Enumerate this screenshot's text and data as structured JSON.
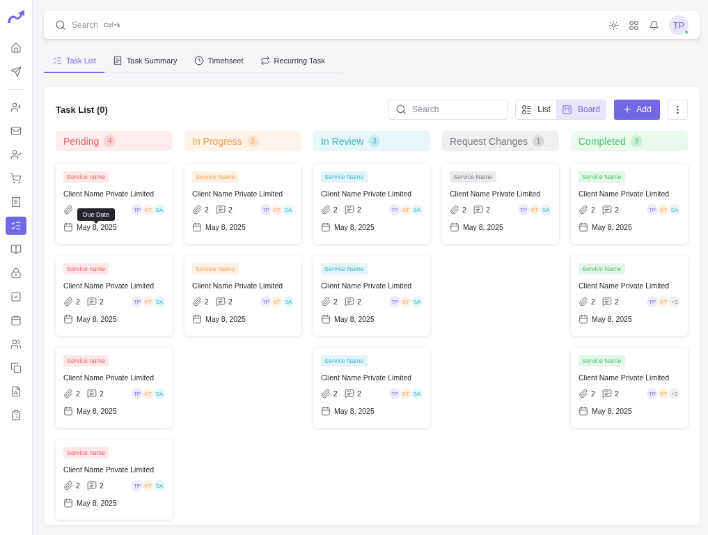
{
  "topbar": {
    "search_placeholder": "Search",
    "shortcut": "Ctrl+k",
    "avatar": "TP",
    "online": true
  },
  "sidebar": {
    "top": [
      {
        "kind": "home",
        "selected": false
      },
      {
        "kind": "send",
        "selected": false
      }
    ],
    "items": [
      {
        "kind": "user-plus",
        "selected": false
      },
      {
        "kind": "mail",
        "selected": false
      },
      {
        "kind": "user-check",
        "selected": false
      },
      {
        "kind": "cart",
        "selected": false
      },
      {
        "kind": "receipt",
        "selected": false
      },
      {
        "kind": "list-checks",
        "selected": true
      },
      {
        "kind": "book",
        "selected": false
      },
      {
        "kind": "lock",
        "selected": false
      },
      {
        "kind": "square-check",
        "selected": false
      },
      {
        "kind": "calendar",
        "selected": false
      },
      {
        "kind": "users",
        "selected": false
      },
      {
        "kind": "copy",
        "selected": false
      },
      {
        "kind": "clipboard-search",
        "selected": false
      },
      {
        "kind": "clipboard-chart",
        "selected": false
      }
    ]
  },
  "tabs": [
    {
      "label": "Task List",
      "kind": "list-checks",
      "selected": true
    },
    {
      "label": "Task Summary",
      "kind": "receipt",
      "selected": false
    },
    {
      "label": "Timehseet",
      "kind": "clock",
      "selected": false
    },
    {
      "label": "Recurring Task",
      "kind": "repeat",
      "selected": false
    }
  ],
  "panel": {
    "title": "Task List (0)",
    "search_placeholder": "Search",
    "views": [
      {
        "label": "List",
        "kind": "list",
        "selected": false
      },
      {
        "label": "Board",
        "kind": "board",
        "selected": true
      }
    ],
    "add_label": "Add"
  },
  "columns": [
    {
      "title": "Pending",
      "count": "4",
      "color": "#ef5f67",
      "cards": [
        {
          "service": "Service name",
          "client": "Client Name Private Limited",
          "date": "May 8, 2025",
          "tooltip": "Due Date",
          "avatars": [
            {
              "initials": "TP",
              "kind": "person"
            },
            {
              "initials": "KT",
              "kind": "person"
            },
            {
              "initials": "SA",
              "kind": "person"
            }
          ]
        },
        {
          "service": "Service name",
          "client": "Client Name Private Limited",
          "attachments": "2",
          "comments": "2",
          "date": "May 8, 2025",
          "avatars": [
            {
              "initials": "TP",
              "kind": "person"
            },
            {
              "initials": "KT",
              "kind": "person"
            },
            {
              "initials": "SA",
              "kind": "person"
            }
          ]
        },
        {
          "service": "Service name",
          "client": "Client Name Private Limited",
          "attachments": "2",
          "comments": "2",
          "date": "May 8, 2025",
          "avatars": [
            {
              "initials": "TP",
              "kind": "person"
            },
            {
              "initials": "KT",
              "kind": "person"
            },
            {
              "initials": "SA",
              "kind": "person"
            }
          ]
        },
        {
          "service": "Service name",
          "client": "Client Name Private Limited",
          "attachments": "2",
          "comments": "2",
          "date": "May 8, 2025",
          "avatars": [
            {
              "initials": "TP",
              "kind": "person"
            },
            {
              "initials": "KT",
              "kind": "person"
            },
            {
              "initials": "SA",
              "kind": "person"
            }
          ]
        }
      ]
    },
    {
      "title": "In Progress",
      "count": "2",
      "color": "#f59e4c",
      "cards": [
        {
          "service": "Service Name",
          "client": "Client Name Private Limited",
          "attachments": "2",
          "comments": "2",
          "date": "May 8, 2025",
          "avatars": [
            {
              "initials": "TP",
              "kind": "person"
            },
            {
              "initials": "KT",
              "kind": "person"
            },
            {
              "initials": "SA",
              "kind": "person"
            }
          ]
        },
        {
          "service": "Service Name",
          "client": "Client Name Private Limited",
          "attachments": "2",
          "comments": "2",
          "date": "May 8, 2025",
          "avatars": [
            {
              "initials": "TP",
              "kind": "person"
            },
            {
              "initials": "KT",
              "kind": "person"
            },
            {
              "initials": "SA",
              "kind": "person"
            }
          ]
        }
      ]
    },
    {
      "title": "In Review",
      "count": "3",
      "color": "#3bb6cf",
      "cards": [
        {
          "service": "Service Name",
          "client": "Client Name Private Limited",
          "attachments": "2",
          "comments": "2",
          "date": "May 8, 2025",
          "avatars": [
            {
              "initials": "TP",
              "kind": "person"
            },
            {
              "initials": "KT",
              "kind": "person"
            },
            {
              "initials": "SA",
              "kind": "person"
            }
          ]
        },
        {
          "service": "Service Name",
          "client": "Client Name Private Limited",
          "attachments": "2",
          "comments": "2",
          "date": "May 8, 2025",
          "avatars": [
            {
              "initials": "TP",
              "kind": "person"
            },
            {
              "initials": "KT",
              "kind": "person"
            },
            {
              "initials": "SA",
              "kind": "person"
            }
          ]
        },
        {
          "service": "Service Name",
          "client": "Client Name Private Limited",
          "attachments": "2",
          "comments": "2",
          "date": "May 8, 2025",
          "avatars": [
            {
              "initials": "TP",
              "kind": "person"
            },
            {
              "initials": "KT",
              "kind": "person"
            },
            {
              "initials": "SA",
              "kind": "person"
            }
          ]
        }
      ]
    },
    {
      "title": "Request Changes",
      "count": "1",
      "color": "#7a7a84",
      "cards": [
        {
          "service": "Service Name",
          "client": "Client Name Private Limited",
          "attachments": "2",
          "comments": "2",
          "date": "May 8, 2025",
          "avatars": [
            {
              "initials": "TP",
              "kind": "person"
            },
            {
              "initials": "KT",
              "kind": "person"
            },
            {
              "initials": "SA",
              "kind": "person"
            }
          ]
        }
      ]
    },
    {
      "title": "Completed",
      "count": "3",
      "color": "#4cc46f",
      "cards": [
        {
          "service": "Service Name",
          "client": "Client Name Private Limited",
          "attachments": "2",
          "comments": "2",
          "date": "May 8, 2025",
          "avatars": [
            {
              "initials": "TP",
              "kind": "person"
            },
            {
              "initials": "KT",
              "kind": "person"
            },
            {
              "initials": "SA",
              "kind": "person"
            }
          ]
        },
        {
          "service": "Service Name",
          "client": "Client Name Private Limited",
          "attachments": "2",
          "comments": "2",
          "date": "May 8, 2025",
          "avatars": [
            {
              "initials": "TP",
              "kind": "person"
            },
            {
              "initials": "KT",
              "kind": "person"
            },
            {
              "initials": "+3",
              "kind": "more"
            }
          ]
        },
        {
          "service": "Service Name",
          "client": "Client Name Private Limited",
          "attachments": "2",
          "comments": "2",
          "date": "May 8, 2025",
          "avatars": [
            {
              "initials": "TP",
              "kind": "person"
            },
            {
              "initials": "KT",
              "kind": "person"
            },
            {
              "initials": "+3",
              "kind": "more"
            }
          ]
        }
      ]
    }
  ]
}
